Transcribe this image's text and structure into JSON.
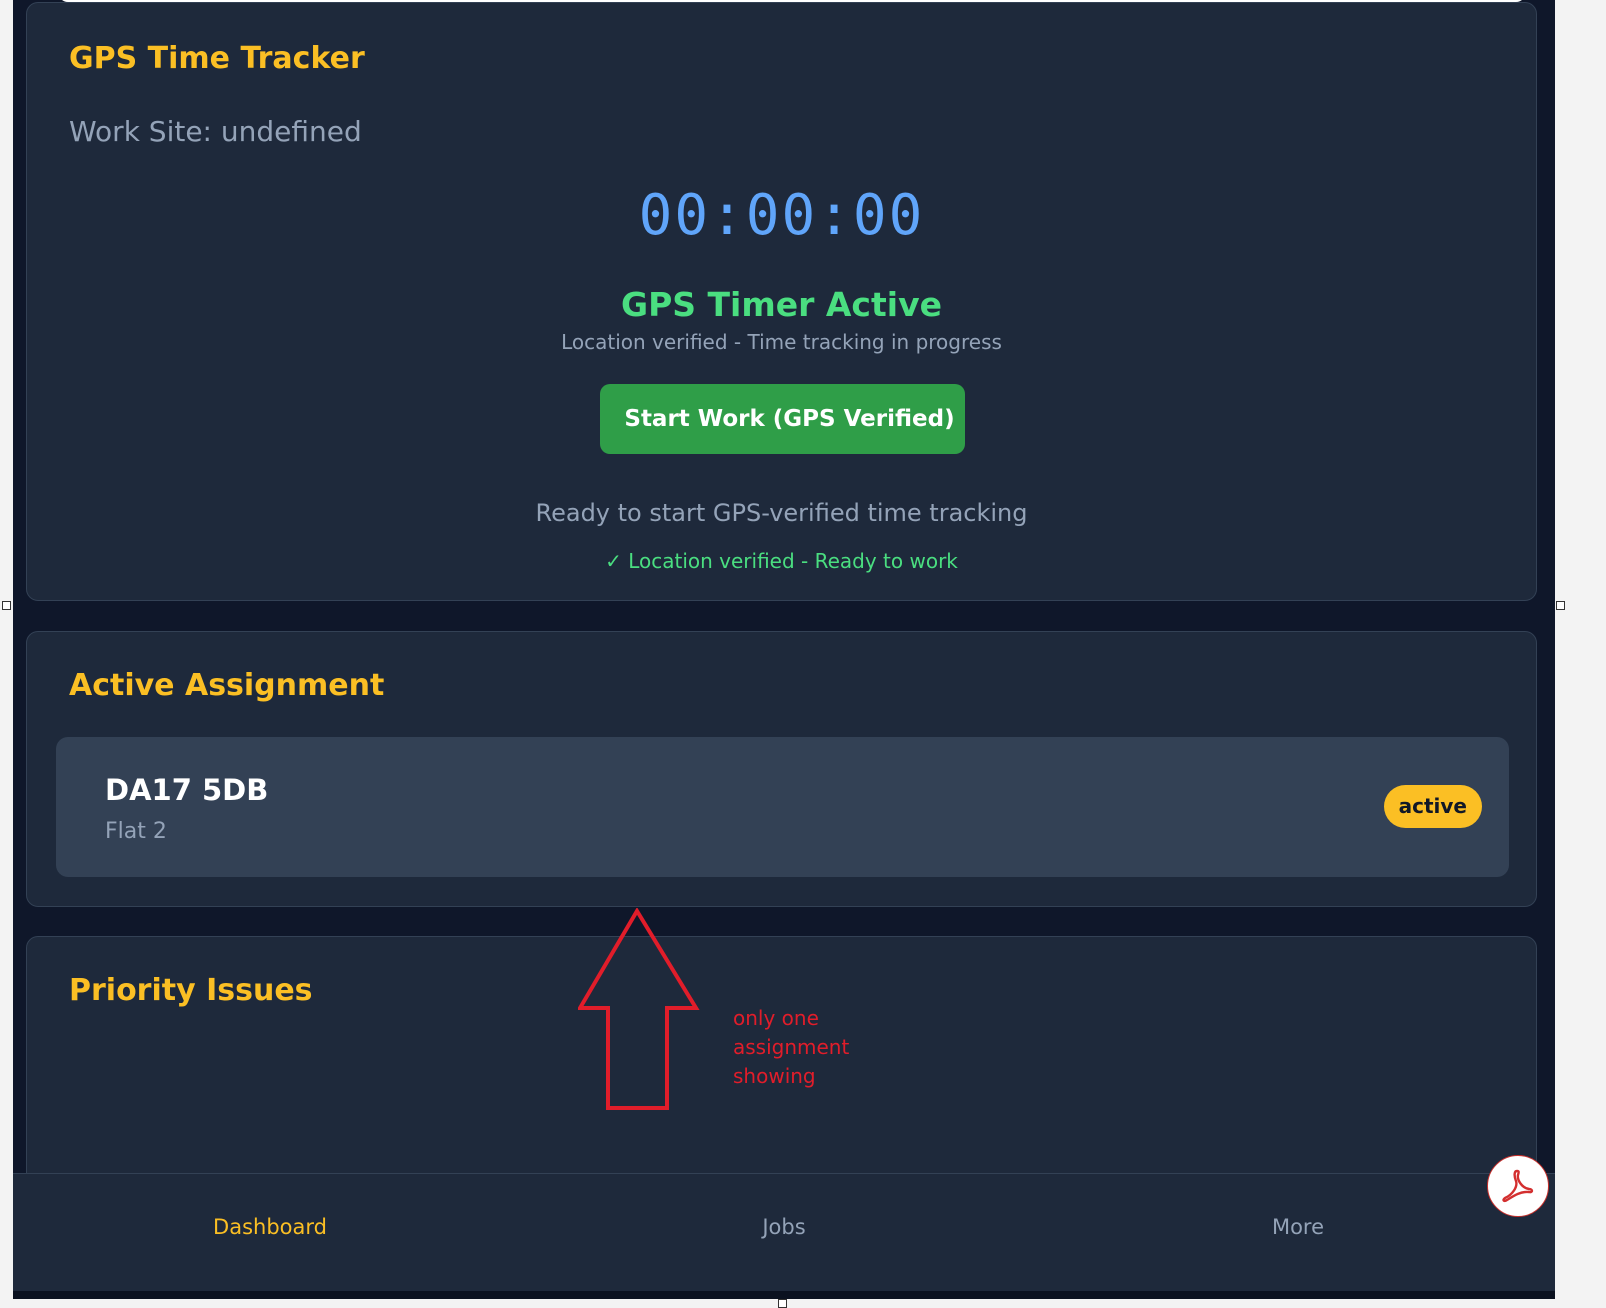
{
  "gps_tracker": {
    "title": "GPS Time Tracker",
    "work_site": "Work Site: undefined",
    "timer": "00:00:00",
    "status": "GPS Timer Active",
    "status_detail": "Location verified - Time tracking in progress",
    "start_button_label": "Start Work (GPS Verified)",
    "ready_message": "Ready to start GPS-verified time tracking",
    "verified_message": "✓ Location verified - Ready to work"
  },
  "active_assignment": {
    "title": "Active Assignment",
    "items": [
      {
        "code": "DA17 5DB",
        "subtitle": "Flat 2",
        "status": "active"
      }
    ]
  },
  "priority_issues": {
    "title": "Priority Issues"
  },
  "bottom_nav": {
    "items": [
      {
        "label": "Dashboard",
        "active": true
      },
      {
        "label": "Jobs",
        "active": false
      },
      {
        "label": "More",
        "active": false
      }
    ]
  },
  "annotation": {
    "note": "only one\nassignment\nshowing",
    "color": "#e11d2a"
  },
  "colors": {
    "background": "#0f172a",
    "card": "#1e293b",
    "accent_yellow": "#fbbf24",
    "timer_blue": "#60a5fa",
    "success_green": "#4ade80",
    "button_green": "#2f9e48",
    "muted_text": "#94a3b8"
  },
  "icons": {
    "floating_button": "pdf-icon"
  }
}
